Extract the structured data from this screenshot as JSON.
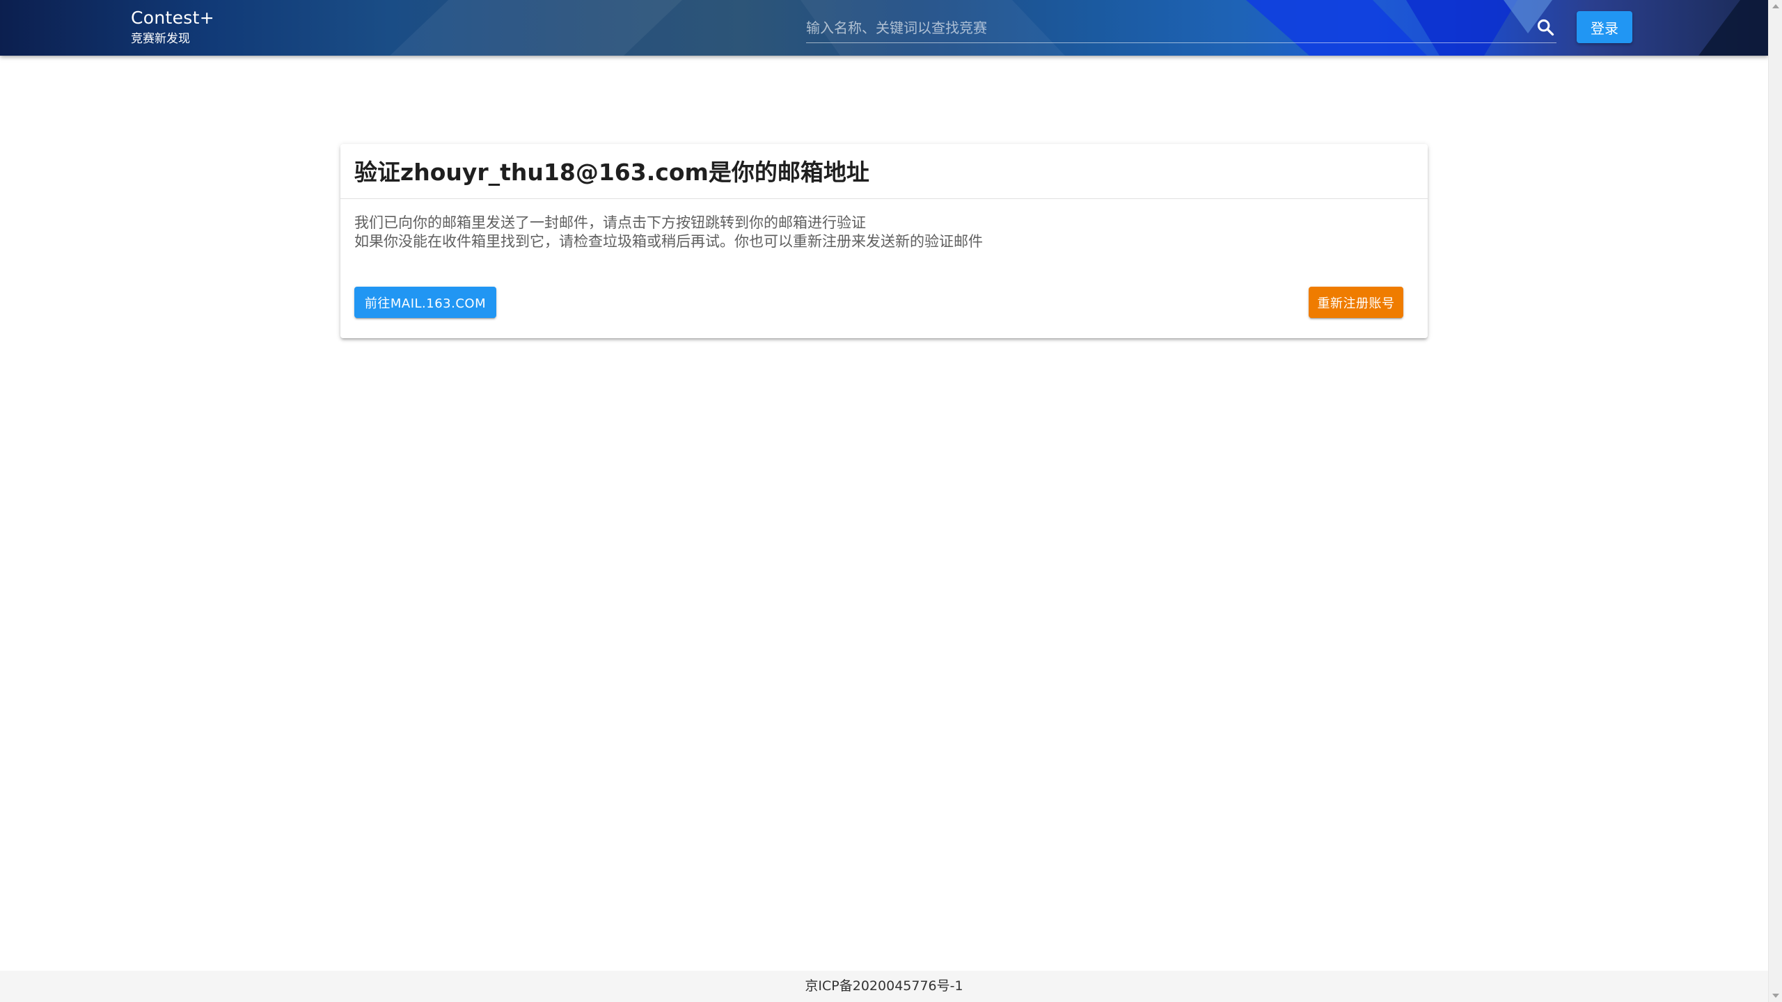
{
  "header": {
    "brand_title": "Contest+",
    "brand_subtitle": "竞赛新发现",
    "search_placeholder": "输入名称、关键词以查找竞赛",
    "search_icon": "search-icon",
    "login_label": "登录"
  },
  "card": {
    "title": "验证zhouyr_thu18@163.com是你的邮箱地址",
    "line1": "我们已向你的邮箱里发送了一封邮件，请点击下方按钮跳转到你的邮箱进行验证",
    "line2": "如果你没能在收件箱里找到它，请检查垃圾箱或稍后再试。你也可以重新注册来发送新的验证邮件",
    "primary_button": "前往MAIL.163.COM",
    "secondary_button": "重新注册账号"
  },
  "footer": {
    "icp": "京ICP备2020045776号-1"
  },
  "colors": {
    "primary": "#2196f3",
    "warning": "#ef7c00",
    "header_dark": "#0c1f4f"
  }
}
